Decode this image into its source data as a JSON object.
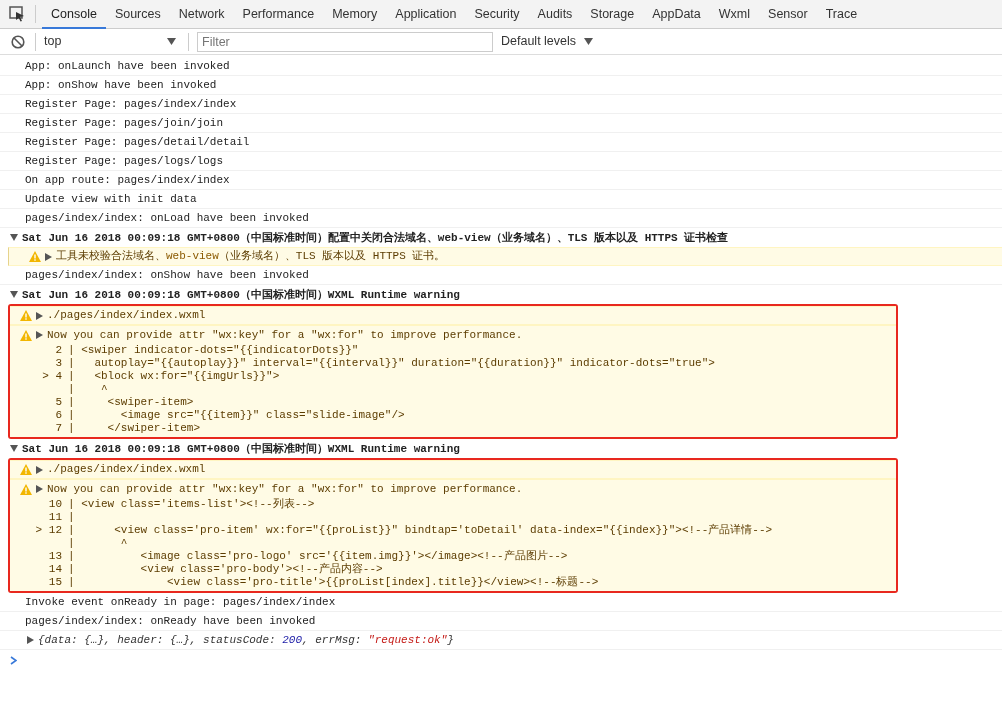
{
  "tabs": [
    {
      "label": "Console",
      "selected": true
    },
    {
      "label": "Sources",
      "selected": false
    },
    {
      "label": "Network",
      "selected": false
    },
    {
      "label": "Performance",
      "selected": false
    },
    {
      "label": "Memory",
      "selected": false
    },
    {
      "label": "Application",
      "selected": false
    },
    {
      "label": "Security",
      "selected": false
    },
    {
      "label": "Audits",
      "selected": false
    },
    {
      "label": "Storage",
      "selected": false
    },
    {
      "label": "AppData",
      "selected": false
    },
    {
      "label": "Wxml",
      "selected": false
    },
    {
      "label": "Sensor",
      "selected": false
    },
    {
      "label": "Trace",
      "selected": false
    }
  ],
  "toolbar": {
    "context": "top",
    "filter": {
      "placeholder": "Filter"
    },
    "levels": "Default levels"
  },
  "entries": [
    {
      "kind": "log",
      "text": "App: onLaunch have been invoked"
    },
    {
      "kind": "log",
      "text": "App: onShow have been invoked"
    },
    {
      "kind": "log",
      "text": "Register Page: pages/index/index"
    },
    {
      "kind": "log",
      "text": "Register Page: pages/join/join"
    },
    {
      "kind": "log",
      "text": "Register Page: pages/detail/detail"
    },
    {
      "kind": "log",
      "text": "Register Page: pages/logs/logs"
    },
    {
      "kind": "log",
      "text": "On app route: pages/index/index"
    },
    {
      "kind": "log",
      "text": "Update view with init data"
    },
    {
      "kind": "log",
      "text": "pages/index/index: onLoad have been invoked"
    },
    {
      "kind": "group",
      "expanded": true,
      "text": "Sat Jun 16 2018 00:09:18 GMT+0800（中国标准时间）配置中关闭合法域名、web-view（业务域名）、TLS 版本以及 HTTPS 证书检查"
    },
    {
      "kind": "warning",
      "parts": [
        {
          "kind": "plain",
          "text": "工具未校验合法域名、"
        },
        {
          "kind": "code",
          "text": "web-view"
        },
        {
          "kind": "plain",
          "text": "（业务域名）、TLS 版本以及 HTTPS 证书。"
        }
      ]
    },
    {
      "kind": "log",
      "text": "pages/index/index: onShow have been invoked"
    },
    {
      "kind": "group",
      "expanded": true,
      "text": "Sat Jun 16 2018 00:09:18 GMT+0800（中国标准时间）WXML Runtime warning"
    },
    {
      "kind": "block",
      "highlighted": true,
      "file": "./pages/index/index.wxml",
      "message": "Now you can provide attr \"wx:key\" for a \"wx:for\" to improve performance.",
      "lines": [
        {
          "number": "2",
          "text": "| <swiper indicator-dots=\"{{indicatorDots}}\""
        },
        {
          "number": "3",
          "text": "|   autoplay=\"{{autoplay}}\" interval=\"{{interval}}\" duration=\"{{duration}}\" indicator-dots=\"true\">"
        },
        {
          "number": "> 4",
          "text": "|   <block wx:for=\"{{imgUrls}}\">"
        },
        {
          "text": "|    ^"
        },
        {
          "number": "5",
          "text": "|     <swiper-item>"
        },
        {
          "number": "6",
          "text": "|       <image src=\"{{item}}\" class=\"slide-image\"/>"
        },
        {
          "number": "7",
          "text": "|     </swiper-item>"
        }
      ]
    },
    {
      "kind": "group",
      "expanded": true,
      "text": "Sat Jun 16 2018 00:09:18 GMT+0800（中国标准时间）WXML Runtime warning"
    },
    {
      "kind": "block",
      "highlighted": true,
      "file": "./pages/index/index.wxml",
      "message": "Now you can provide attr \"wx:key\" for a \"wx:for\" to improve performance.",
      "lines": [
        {
          "number": "10",
          "text": "| <view class='items-list'><!--列表-->"
        },
        {
          "number": "11",
          "text": "|"
        },
        {
          "number": "> 12",
          "text": "|      <view class='pro-item' wx:for=\"{{proList}}\" bindtap='toDetail' data-index=\"{{index}}\"><!--产品详情-->"
        },
        {
          "text": "|       ^"
        },
        {
          "number": "13",
          "text": "|          <image class='pro-logo' src='{{item.img}}'></image><!--产品图片-->"
        },
        {
          "number": "14",
          "text": "|          <view class='pro-body'><!--产品内容-->"
        },
        {
          "number": "15",
          "text": "|              <view class='pro-title'>{{proList[index].title}}</view><!--标题-->"
        }
      ]
    },
    {
      "kind": "log",
      "text": "Invoke event onReady in page: pages/index/index"
    },
    {
      "kind": "log",
      "text": "pages/index/index: onReady have been invoked"
    },
    {
      "kind": "object",
      "parts": [
        {
          "kind": "plain",
          "text": "{data: {…}, header: {…}, statusCode: "
        },
        {
          "kind": "number",
          "text": "200"
        },
        {
          "kind": "plain",
          "text": ", errMsg: "
        },
        {
          "kind": "string",
          "text": "\"request:ok\""
        },
        {
          "kind": "plain",
          "text": "}"
        }
      ]
    }
  ]
}
